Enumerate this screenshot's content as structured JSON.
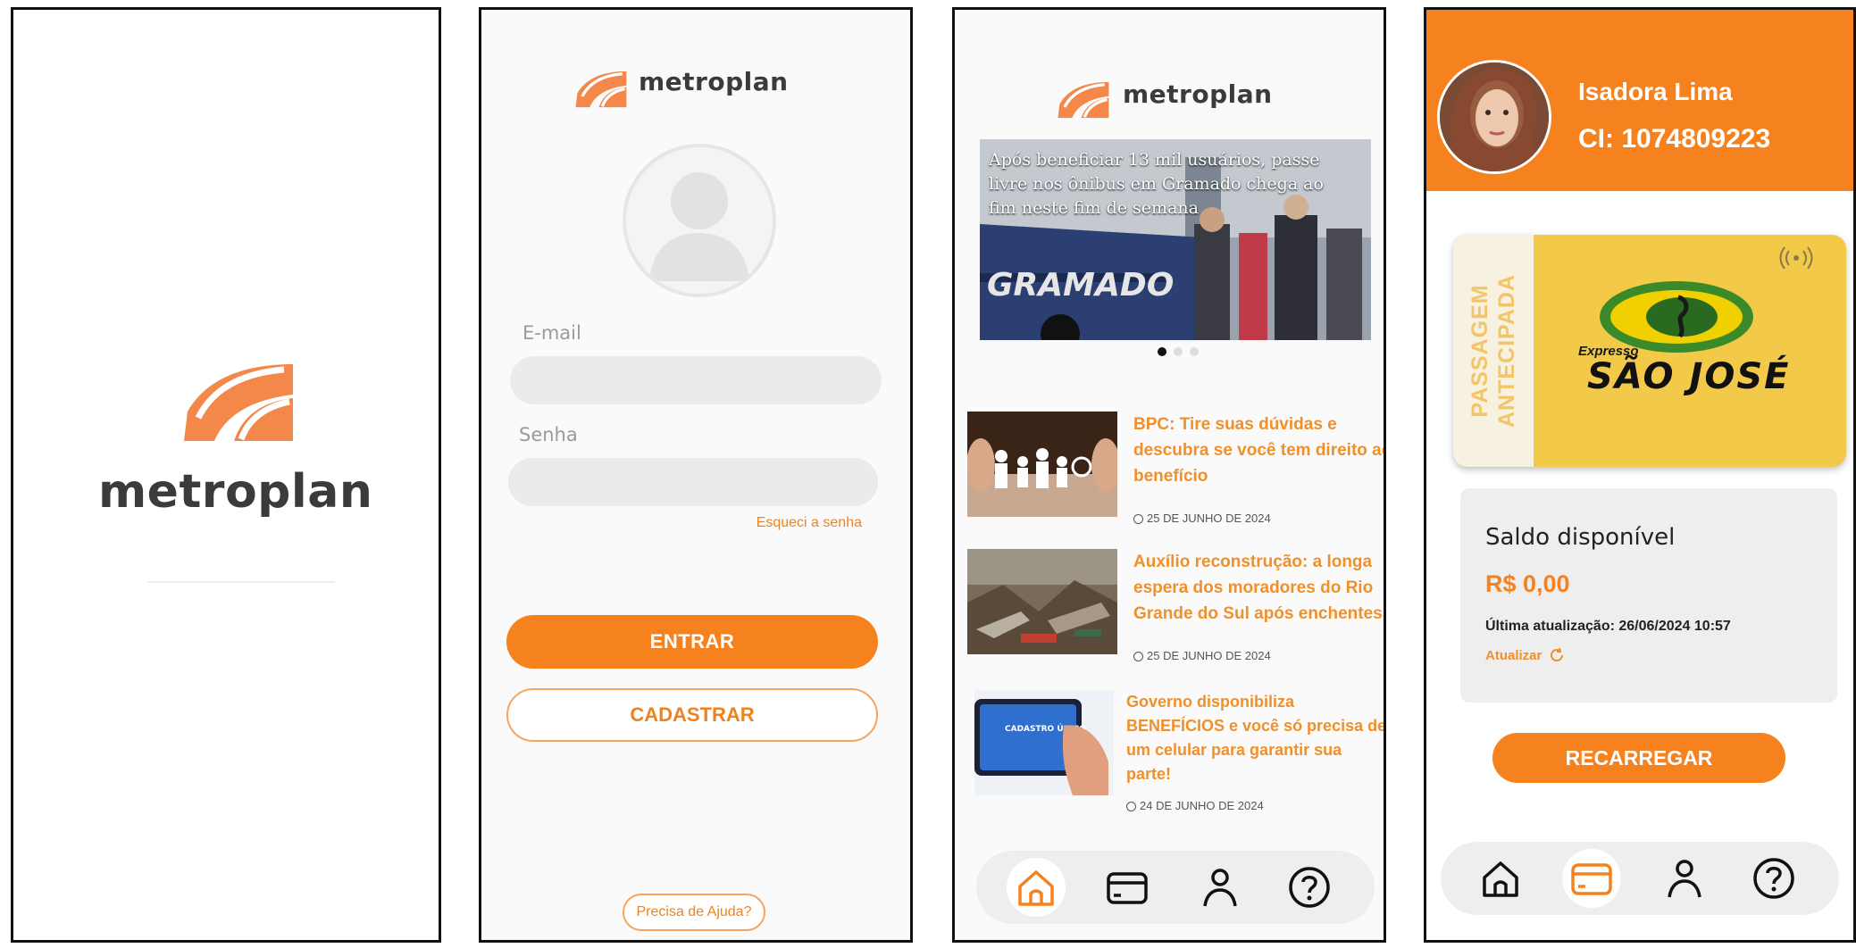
{
  "brand": {
    "name": "metroplan",
    "accent": "#f5821f",
    "logo_color": "#f4884a"
  },
  "splash": {
    "logo_text": "metroplan"
  },
  "login": {
    "logo_text": "metroplan",
    "email_label": "E-mail",
    "email_value": "",
    "password_label": "Senha",
    "password_value": "",
    "forgot_link": "Esqueci a senha",
    "login_button": "ENTRAR",
    "register_button": "CADASTRAR",
    "help_button": "Precisa de Ajuda?"
  },
  "news": {
    "logo_text": "metroplan",
    "hero_caption": "Após beneficiar 13 mil usuários, passe livre nos ônibus em Gramado chega ao fim neste fim de semana",
    "hero_bus_text": "GRAMADO",
    "carousel": {
      "count": 3,
      "active_index": 0
    },
    "items": [
      {
        "title": "BPC: Tire suas dúvidas e descubra se você tem direito ao benefício",
        "date": "25 DE JUNHO DE 2024",
        "thumb": "paper-family-icon"
      },
      {
        "title": "Auxílio reconstrução: a longa espera dos moradores do Rio Grande do Sul após enchentes",
        "date": "25 DE JUNHO DE 2024",
        "thumb": "flood-debris-icon"
      },
      {
        "title": "Governo disponibiliza BENEFÍCIOS e você só precisa de um celular para garantir sua parte!",
        "date": "24 DE JUNHO DE 2024",
        "thumb": "phone-cadastro-icon"
      }
    ],
    "thumb_phone_text": "CADASTRO ÚNICO"
  },
  "nav": {
    "items": [
      "home-icon",
      "card-icon",
      "user-icon",
      "help-icon"
    ],
    "active_news": "home-icon",
    "active_wallet": "card-icon"
  },
  "wallet": {
    "user_name": "Isadora Lima",
    "user_ci": "CI: 1074809223",
    "card_side_text_1": "PASSAGEM",
    "card_side_text_2": "ANTECIPADA",
    "card_brand_small": "Expresso",
    "card_brand_big": "SÃO JOSÉ",
    "balance_title": "Saldo disponível",
    "balance_value": "R$ 0,00",
    "last_update": "Última atualização: 26/06/2024 10:57",
    "refresh_label": "Atualizar",
    "recharge_button": "RECARREGAR"
  }
}
